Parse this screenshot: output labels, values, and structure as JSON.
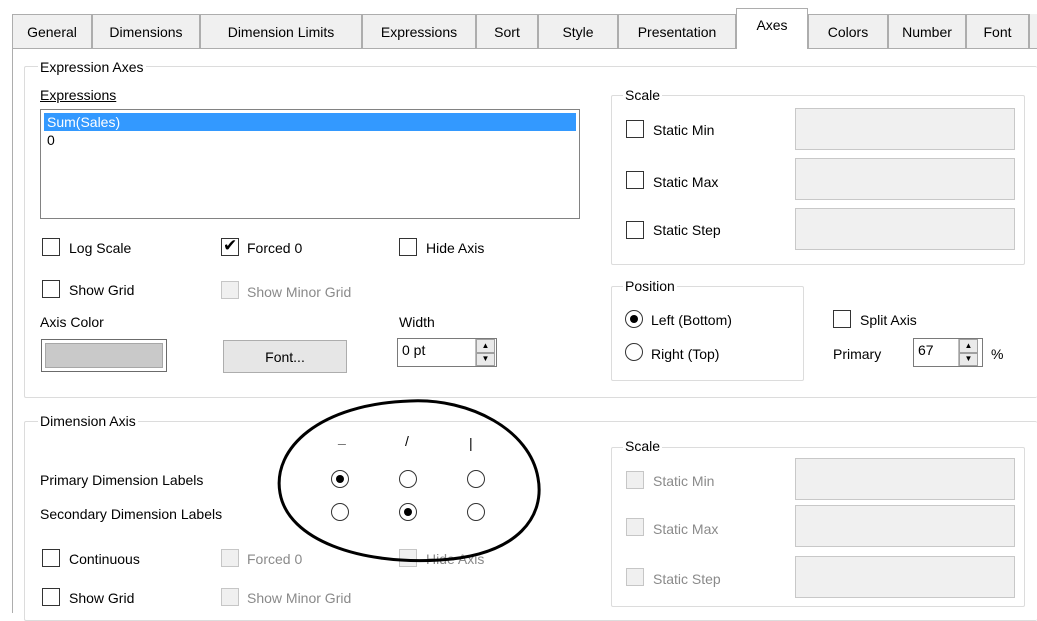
{
  "tabs": [
    {
      "label": "General"
    },
    {
      "label": "Dimensions"
    },
    {
      "label": "Dimension Limits"
    },
    {
      "label": "Expressions"
    },
    {
      "label": "Sort"
    },
    {
      "label": "Style"
    },
    {
      "label": "Presentation"
    },
    {
      "label": "Axes",
      "active": true
    },
    {
      "label": "Colors"
    },
    {
      "label": "Number"
    },
    {
      "label": "Font"
    }
  ],
  "expression_axes": {
    "title": "Expression Axes",
    "expressions_label": "Expressions",
    "expressions": [
      "Sum(Sales)",
      "0"
    ],
    "selected_index": 0,
    "log_scale": {
      "label": "Log Scale",
      "checked": false
    },
    "forced_0": {
      "label": "Forced 0",
      "checked": true
    },
    "hide_axis": {
      "label": "Hide Axis",
      "checked": false
    },
    "show_grid": {
      "label": "Show Grid",
      "checked": false
    },
    "show_minor_grid": {
      "label": "Show Minor Grid",
      "checked": false,
      "disabled": true
    },
    "axis_color_label": "Axis Color",
    "axis_color": "#c9c9c9",
    "font_button": "Font...",
    "width_label": "Width",
    "width_value": "0 pt"
  },
  "scale_top": {
    "title": "Scale",
    "static_min": {
      "label": "Static Min",
      "checked": false,
      "value": ""
    },
    "static_max": {
      "label": "Static Max",
      "checked": false,
      "value": ""
    },
    "static_step": {
      "label": "Static Step",
      "checked": false,
      "value": ""
    }
  },
  "position": {
    "title": "Position",
    "left_bottom": {
      "label": "Left (Bottom)",
      "selected": true
    },
    "right_top": {
      "label": "Right (Top)",
      "selected": false
    }
  },
  "split_axis": {
    "label": "Split Axis",
    "checked": false,
    "primary_label": "Primary",
    "primary_value": "67",
    "unit": "%"
  },
  "dimension_axis": {
    "title": "Dimension Axis",
    "orientation_headers": [
      "_",
      "/",
      "|"
    ],
    "primary_labels": {
      "label": "Primary Dimension Labels",
      "selected_index": 0
    },
    "secondary_labels": {
      "label": "Secondary Dimension Labels",
      "selected_index": 1
    },
    "continuous": {
      "label": "Continuous",
      "checked": false
    },
    "forced_0": {
      "label": "Forced 0",
      "checked": false,
      "disabled": true
    },
    "hide_axis": {
      "label": "Hide Axis",
      "checked": false,
      "disabled": true
    },
    "show_grid": {
      "label": "Show Grid",
      "checked": false
    },
    "show_minor_grid": {
      "label": "Show Minor Grid",
      "checked": false,
      "disabled": true
    }
  },
  "scale_bottom": {
    "title": "Scale",
    "static_min": {
      "label": "Static Min",
      "disabled": true,
      "value": ""
    },
    "static_max": {
      "label": "Static Max",
      "disabled": true,
      "value": ""
    },
    "static_step": {
      "label": "Static Step",
      "disabled": true,
      "value": ""
    }
  }
}
